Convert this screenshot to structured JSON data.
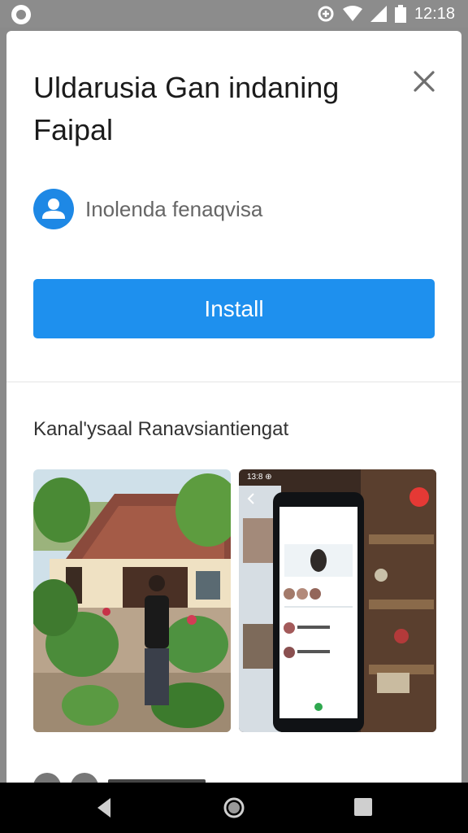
{
  "status": {
    "time": "12:18"
  },
  "dialog": {
    "title": "Uldarusia Gan indaning Faipal",
    "developer": "Inolenda fenaqvisa",
    "install_label": "Install"
  },
  "screenshots": {
    "section_title": "Kanal'ysaal Ranavsiantiengat",
    "items": [
      {
        "name": "house-garden-photo"
      },
      {
        "name": "app-phone-screenshot",
        "overlay_time": "13:8 ⊕"
      }
    ]
  },
  "colors": {
    "accent": "#1e90ee",
    "status_bar": "#8c8c8c",
    "nav_bar": "#000000"
  }
}
